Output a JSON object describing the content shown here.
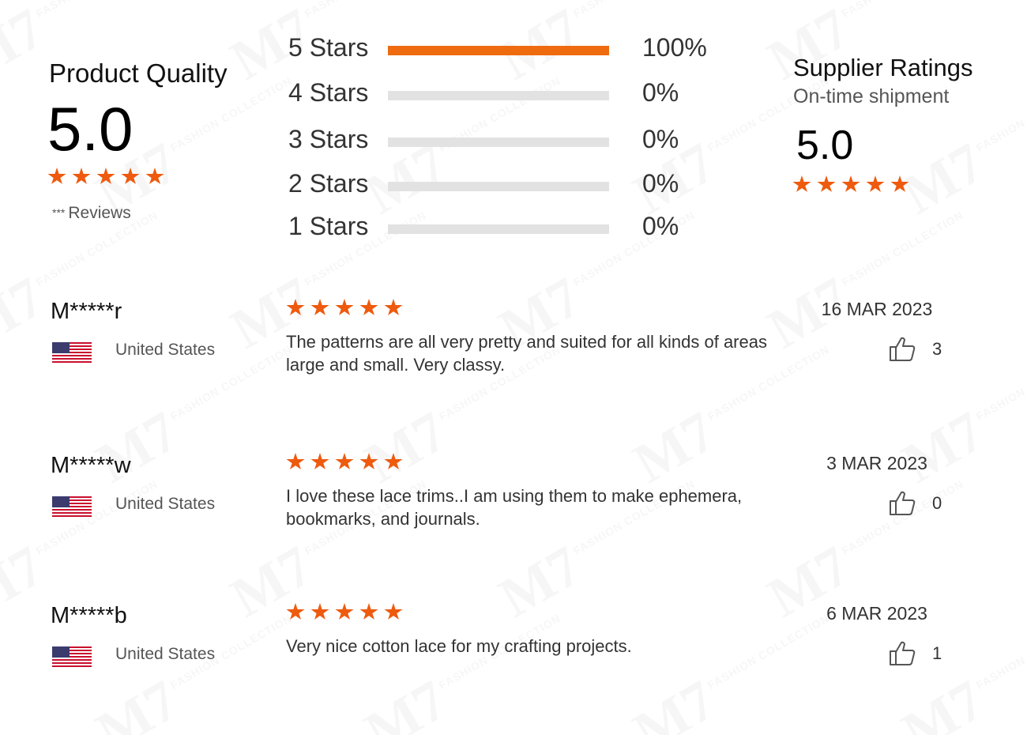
{
  "product_quality": {
    "label": "Product Quality",
    "score": "5.0",
    "star_rating": 5,
    "reviews_mask": "***",
    "reviews_label": "Reviews"
  },
  "distribution": [
    {
      "label": "5 Stars",
      "percent_text": "100%",
      "percent": 100
    },
    {
      "label": "4 Stars",
      "percent_text": "0%",
      "percent": 0
    },
    {
      "label": "3 Stars",
      "percent_text": "0%",
      "percent": 0
    },
    {
      "label": "2 Stars",
      "percent_text": "0%",
      "percent": 0
    },
    {
      "label": "1 Stars",
      "percent_text": "0%",
      "percent": 0
    }
  ],
  "supplier": {
    "label": "Supplier Ratings",
    "sublabel": "On-time shipment",
    "score": "5.0",
    "star_rating": 5
  },
  "reviews": [
    {
      "name": "M*****r",
      "country": "United States",
      "stars": 5,
      "text": "The patterns are all very pretty and suited for all kinds of areas large and small. Very classy.",
      "date": "16 MAR 2023",
      "likes": "3"
    },
    {
      "name": "M*****w",
      "country": "United States",
      "stars": 5,
      "text": "I love these lace trims..I am using them to make ephemera, bookmarks, and journals.",
      "date": "3 MAR 2023",
      "likes": "0"
    },
    {
      "name": "M*****b",
      "country": "United States",
      "stars": 5,
      "text": "Very nice cotton lace for my crafting projects.",
      "date": "6 MAR 2023",
      "likes": "1"
    }
  ],
  "watermark": {
    "brand": "M7",
    "sub": "FASHION COLLECTION"
  },
  "colors": {
    "accent": "#ee6b10",
    "star": "#ee5a0e",
    "bar_bg": "#e2e2e2"
  }
}
